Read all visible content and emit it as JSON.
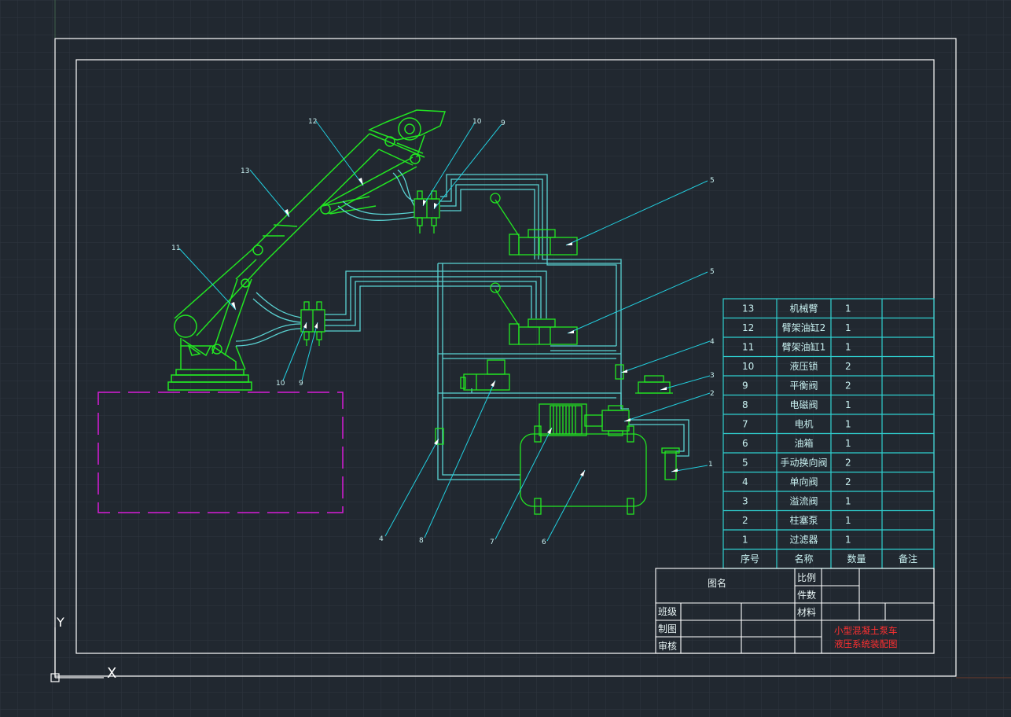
{
  "colors": {
    "background": "#212830",
    "grid": "#2e363f",
    "frame": "#ffffff",
    "machine": "#22e622",
    "pipe": "#5ad3d3",
    "leader": "#22d0e0",
    "table": "#2fd0d0",
    "text_cyan": "#c8f0f0",
    "red_title": "#ff3030",
    "magenta": "#d81cd8"
  },
  "balloons": {
    "b13": "13",
    "b12": "12",
    "b11": "11",
    "b10a": "10",
    "b9a": "9",
    "b10b": "10",
    "b9b": "9",
    "b5a": "5",
    "b5b": "5",
    "b4a": "4",
    "b3": "3",
    "b2": "2",
    "b1": "1",
    "b4b": "4",
    "b8": "8",
    "b7": "7",
    "b6": "6"
  },
  "bom": {
    "rows": [
      {
        "no": "13",
        "name": "机械臂",
        "qty": "1",
        "note": ""
      },
      {
        "no": "12",
        "name": "臂架油缸2",
        "qty": "1",
        "note": ""
      },
      {
        "no": "11",
        "name": "臂架油缸1",
        "qty": "1",
        "note": ""
      },
      {
        "no": "10",
        "name": "液压锁",
        "qty": "2",
        "note": ""
      },
      {
        "no": "9",
        "name": "平衡阀",
        "qty": "2",
        "note": ""
      },
      {
        "no": "8",
        "name": "电磁阀",
        "qty": "1",
        "note": ""
      },
      {
        "no": "7",
        "name": "电机",
        "qty": "1",
        "note": ""
      },
      {
        "no": "6",
        "name": "油箱",
        "qty": "1",
        "note": ""
      },
      {
        "no": "5",
        "name": "手动换向阀",
        "qty": "2",
        "note": ""
      },
      {
        "no": "4",
        "name": "单向阀",
        "qty": "2",
        "note": ""
      },
      {
        "no": "3",
        "name": "溢流阀",
        "qty": "1",
        "note": ""
      },
      {
        "no": "2",
        "name": "柱塞泵",
        "qty": "1",
        "note": ""
      },
      {
        "no": "1",
        "name": "过滤器",
        "qty": "1",
        "note": ""
      }
    ],
    "header": {
      "no": "序号",
      "name": "名称",
      "qty": "数量",
      "note": "备注"
    }
  },
  "title_block": {
    "drawing_name_label": "图名",
    "scale_label": "比例",
    "count_label": "件数",
    "material_label": "材料",
    "class_label": "班级",
    "drawn_label": "制图",
    "checked_label": "审核",
    "title_line1": "小型混凝土泵车",
    "title_line2": "液压系统装配图"
  },
  "ucs": {
    "y_label": "Y",
    "x_label": "X"
  }
}
